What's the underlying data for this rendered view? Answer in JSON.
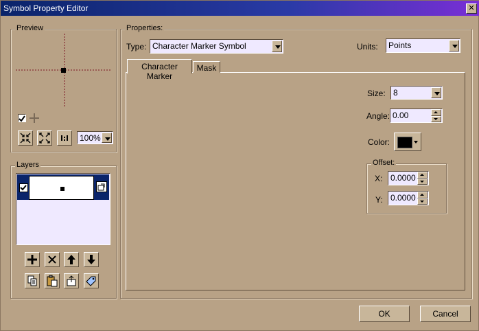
{
  "window": {
    "title": "Symbol Property Editor",
    "close_glyph": "✕"
  },
  "preview": {
    "legend": "Preview",
    "checkbox_checked": true,
    "zoom_value": "100%",
    "buttons": [
      "zoom-in",
      "zoom-out",
      "one-to-one"
    ]
  },
  "layers": {
    "legend": "Layers",
    "selected_row_color": "#0a246a",
    "items": [
      {
        "checked": true
      }
    ],
    "buttons": [
      "add",
      "delete",
      "move-up",
      "move-down",
      "copy",
      "paste",
      "export",
      "tag"
    ]
  },
  "properties": {
    "legend": "Properties:",
    "type_label": "Type:",
    "type_value": "Character Marker Symbol",
    "units_label": "Units:",
    "units_value": "Points",
    "tabs": [
      {
        "label": "Character Marker",
        "active": true
      },
      {
        "label": "Mask",
        "active": false
      }
    ],
    "size_label": "Size:",
    "size_value": "8",
    "angle_label": "Angle:",
    "angle_value": "0.00",
    "color_label": "Color:",
    "color_value": "#000000",
    "offset_legend": "Offset:",
    "x_label": "X:",
    "x_value": "0.0000",
    "y_label": "Y:",
    "y_value": "0.0000"
  },
  "footer": {
    "ok_label": "OK",
    "cancel_label": "Cancel"
  },
  "colors": {
    "dialog_bg": "#b8a286",
    "field_bg": "#efe9ff",
    "title_start": "#0a246a",
    "title_end": "#7a2ed6"
  }
}
